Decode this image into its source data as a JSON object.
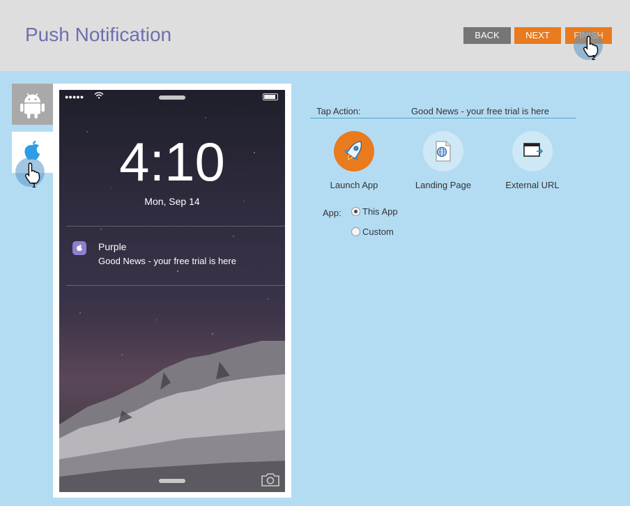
{
  "header": {
    "title": "Push Notification",
    "buttons": {
      "back": "BACK",
      "next": "NEXT",
      "finish": "FINISH"
    }
  },
  "platform_tabs": [
    {
      "name": "android",
      "icon": "android-icon"
    },
    {
      "name": "ios",
      "icon": "apple-icon",
      "selected": true
    }
  ],
  "cursors": [
    {
      "step": "1",
      "icon": "hand-pointer-icon"
    },
    {
      "step": "2",
      "icon": "hand-pointer-icon"
    }
  ],
  "phone": {
    "time": "4:10",
    "date": "Mon, Sep 14",
    "status_signal": "●●●●●",
    "notification": {
      "app": "Purple",
      "message": "Good News - your free trial is here"
    }
  },
  "settings": {
    "tap_action_label": "Tap Action:",
    "tap_action_value": "Good News - your free trial is here",
    "actions": [
      {
        "label": "Launch App",
        "icon": "rocket-icon",
        "selected": true
      },
      {
        "label": "Landing Page",
        "icon": "globe-page-icon",
        "selected": false
      },
      {
        "label": "External URL",
        "icon": "external-window-icon",
        "selected": false
      }
    ],
    "app_label": "App:",
    "app_options": [
      {
        "label": "This App",
        "selected": true
      },
      {
        "label": "Custom",
        "selected": false
      }
    ]
  },
  "colors": {
    "accent": "#e97a1d",
    "title": "#6f6fae",
    "background": "#b3dcf3",
    "header": "#dedede",
    "back_button": "#757575"
  }
}
